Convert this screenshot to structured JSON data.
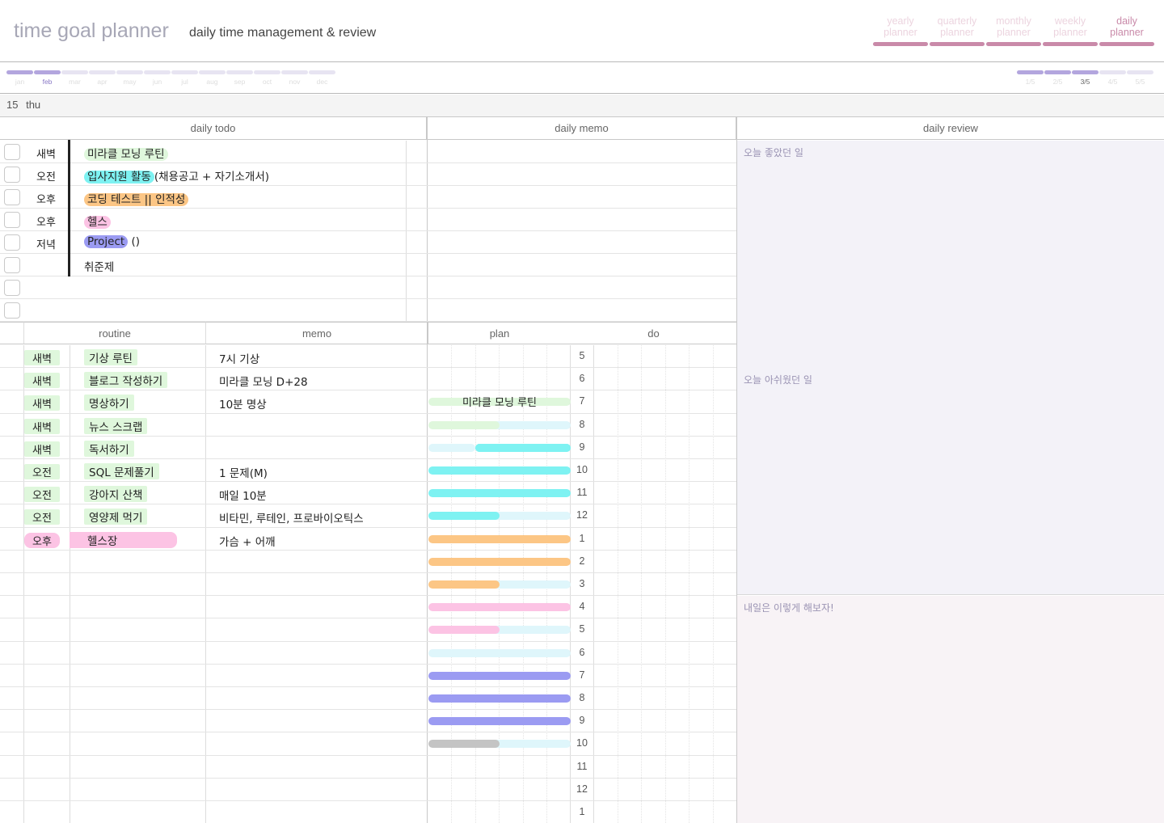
{
  "app": {
    "title": "time goal planner",
    "subtitle": "daily time management & review"
  },
  "planner_nav": [
    {
      "line1": "yearly",
      "line2": "planner",
      "active": false
    },
    {
      "line1": "quarterly",
      "line2": "planner",
      "active": false
    },
    {
      "line1": "monthly",
      "line2": "planner",
      "active": false
    },
    {
      "line1": "weekly",
      "line2": "planner",
      "active": false
    },
    {
      "line1": "daily",
      "line2": "planner",
      "active": true
    }
  ],
  "months": [
    {
      "label": "jan",
      "state": "past"
    },
    {
      "label": "feb",
      "state": "current"
    },
    {
      "label": "mar",
      "state": "future"
    },
    {
      "label": "apr",
      "state": "future"
    },
    {
      "label": "may",
      "state": "future"
    },
    {
      "label": "jun",
      "state": "future"
    },
    {
      "label": "jul",
      "state": "future"
    },
    {
      "label": "aug",
      "state": "future"
    },
    {
      "label": "sep",
      "state": "future"
    },
    {
      "label": "oct",
      "state": "future"
    },
    {
      "label": "nov",
      "state": "future"
    },
    {
      "label": "dec",
      "state": "future"
    }
  ],
  "quarters": [
    {
      "label": "1/5",
      "state": "past"
    },
    {
      "label": "2/5",
      "state": "past"
    },
    {
      "label": "3/5",
      "state": "current"
    },
    {
      "label": "4/5",
      "state": "future"
    },
    {
      "label": "5/5",
      "state": "future"
    }
  ],
  "date": {
    "day": "15",
    "weekday": "thu"
  },
  "headers": {
    "todo": "daily todo",
    "memo": "daily memo",
    "review": "daily review",
    "routine": "routine",
    "routine_memo": "memo",
    "plan": "plan",
    "do": "do"
  },
  "todos": [
    {
      "time": "새벽",
      "text": "미라클 모닝 루틴",
      "suffix": "",
      "highlight": "#dff7dc",
      "checked": false
    },
    {
      "time": "오전",
      "text": "입사지원 활동",
      "suffix": "(채용공고 + 자기소개서)",
      "highlight": "#7ef2f2",
      "checked": false
    },
    {
      "time": "오후",
      "text": "코딩 테스트 || 인적성",
      "suffix": "",
      "highlight": "#fcc685",
      "checked": false
    },
    {
      "time": "오후",
      "text": "헬스",
      "suffix": "",
      "highlight": "#fcc3e4",
      "checked": false
    },
    {
      "time": "저녁",
      "text": "Project",
      "suffix": " ()",
      "highlight": "#9b9bf2",
      "checked": false
    },
    {
      "time": "",
      "text": "취준제",
      "suffix": "",
      "highlight": "",
      "checked": false
    },
    {
      "time": "",
      "text": "",
      "suffix": "",
      "highlight": "",
      "checked": false
    },
    {
      "time": "",
      "text": "",
      "suffix": "",
      "highlight": "",
      "checked": false
    }
  ],
  "routines": [
    {
      "time": "새벽",
      "name": "기상 루틴",
      "memo": "7시 기상",
      "color": "#dff7dc"
    },
    {
      "time": "새벽",
      "name": "블로그 작성하기",
      "memo": "미라클 모닝 D+28",
      "color": "#dff7dc"
    },
    {
      "time": "새벽",
      "name": "명상하기",
      "memo": "10분 명상",
      "color": "#dff7dc"
    },
    {
      "time": "새벽",
      "name": "뉴스 스크랩",
      "memo": "",
      "color": "#dff7dc"
    },
    {
      "time": "새벽",
      "name": "독서하기",
      "memo": "",
      "color": "#dff7dc"
    },
    {
      "time": "오전",
      "name": "SQL 문제풀기",
      "memo": "1 문제(M)",
      "color": "#dff7dc"
    },
    {
      "time": "오전",
      "name": "강아지 산책",
      "memo": "매일 10분",
      "color": "#dff7dc"
    },
    {
      "time": "오전",
      "name": "영양제 먹기",
      "memo": "비타민, 루테인, 프로바이오틱스",
      "color": "#dff7dc"
    },
    {
      "time": "오후",
      "name": "헬스장",
      "memo": "가슴 + 어깨",
      "color": "#fcc3e4"
    }
  ],
  "hours": [
    "5",
    "6",
    "7",
    "8",
    "9",
    "10",
    "11",
    "12",
    "1",
    "2",
    "3",
    "4",
    "5",
    "6",
    "7",
    "8",
    "9",
    "10",
    "11",
    "12",
    "1"
  ],
  "plan_text": "미라클 모닝 루틴",
  "plan_colors": {
    "green": "#dff7dc",
    "light_cyan": "#dff6fb",
    "cyan": "#7ef2f2",
    "orange": "#fcc685",
    "pink": "#fcc3e4",
    "purple": "#9b9bf2",
    "gray": "#c4c4c4"
  },
  "plan": [
    {
      "first": "green",
      "second": "green",
      "text": true
    },
    {
      "first": "green",
      "second": "light_cyan"
    },
    {
      "first": "light_cyan",
      "second": "cyan"
    },
    {
      "first": "cyan",
      "second": "cyan"
    },
    {
      "first": "cyan",
      "second": "cyan"
    },
    {
      "first": "cyan",
      "second": "light_cyan"
    },
    {
      "first": "orange",
      "second": "orange"
    },
    {
      "first": "orange",
      "second": "orange"
    },
    {
      "first": "orange",
      "second": "light_cyan"
    },
    {
      "first": "pink",
      "second": "pink"
    },
    {
      "first": "pink",
      "second": "light_cyan"
    },
    {
      "first": "light_cyan",
      "second": "light_cyan"
    },
    {
      "first": "purple",
      "second": "purple"
    },
    {
      "first": "purple",
      "second": "purple"
    },
    {
      "first": "purple",
      "second": "purple"
    },
    {
      "first": "gray",
      "second": "light_cyan"
    }
  ],
  "review": {
    "good": "오늘 좋았던 일",
    "regret": "오늘 아쉬웠던 일",
    "tomorrow": "내일은 이렇게 해보자!",
    "good_bg": "#f3f2f8",
    "regret_bg": "#f3f2f8",
    "tomorrow_bg": "#f8f3f6"
  }
}
